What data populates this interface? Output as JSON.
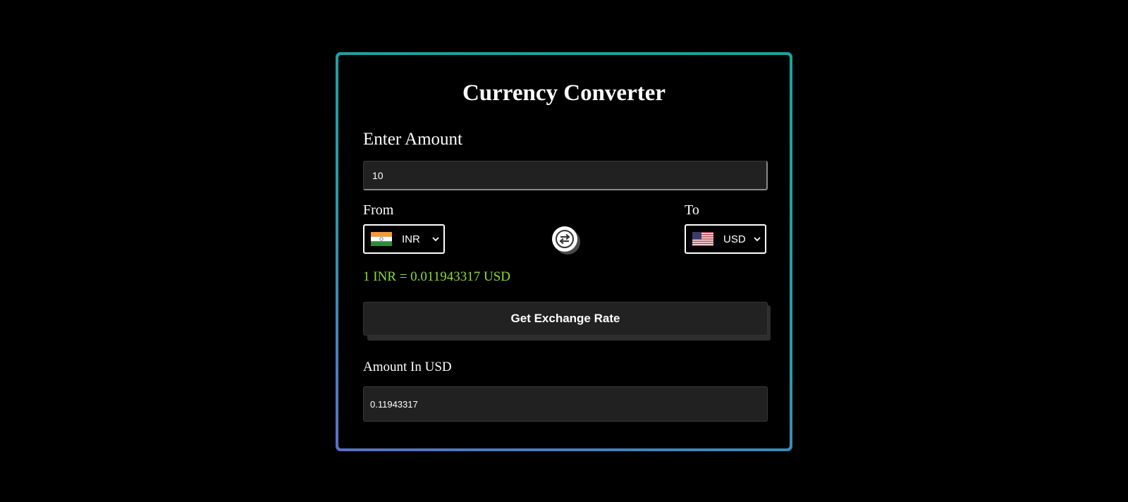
{
  "app": {
    "title": "Currency Converter"
  },
  "amount": {
    "label": "Enter Amount",
    "value": "10"
  },
  "from": {
    "label": "From",
    "code": "INR",
    "flag_icon": "india-flag-icon"
  },
  "to": {
    "label": "To",
    "code": "USD",
    "flag_icon": "usa-flag-icon"
  },
  "swap": {
    "icon": "swap-arrows-icon"
  },
  "rate": {
    "text": "1 INR = 0.011943317 USD"
  },
  "actions": {
    "get_rate_label": "Get Exchange Rate"
  },
  "result": {
    "label": "Amount In USD",
    "value": "0.11943317"
  },
  "colors": {
    "background": "#000000",
    "rate_text": "#8bdc3a",
    "border_gradient_start": "#5b6fc7",
    "border_gradient_end": "#17a59a",
    "input_bg": "#212121"
  }
}
